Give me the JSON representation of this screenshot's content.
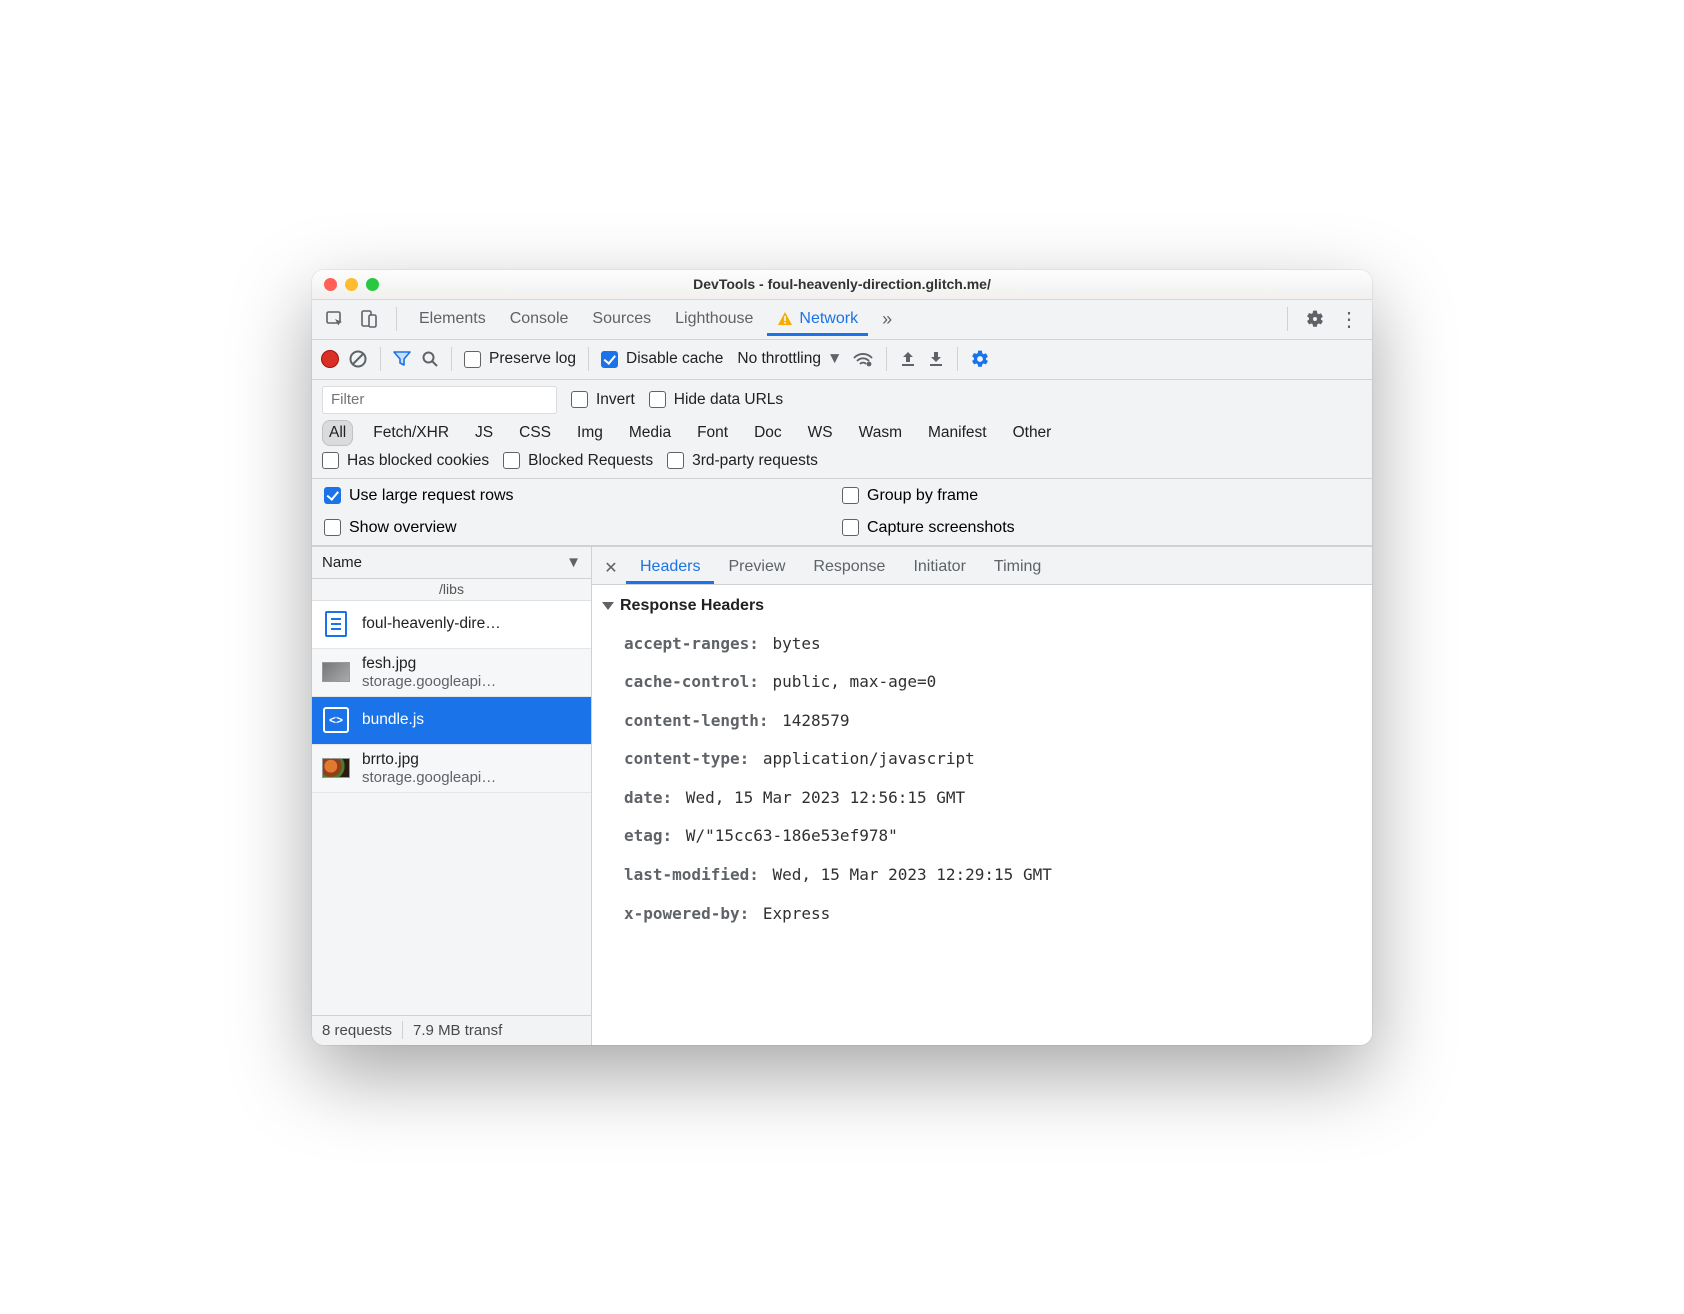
{
  "window_title": "DevTools - foul-heavenly-direction.glitch.me/",
  "top_tabs": {
    "elements": "Elements",
    "console": "Console",
    "sources": "Sources",
    "lighthouse": "Lighthouse",
    "network": "Network"
  },
  "toolbar": {
    "preserve_log": "Preserve log",
    "disable_cache": "Disable cache",
    "throttling": "No throttling"
  },
  "filter": {
    "placeholder": "Filter",
    "invert": "Invert",
    "hide_data_urls": "Hide data URLs",
    "types": [
      "All",
      "Fetch/XHR",
      "JS",
      "CSS",
      "Img",
      "Media",
      "Font",
      "Doc",
      "WS",
      "Wasm",
      "Manifest",
      "Other"
    ],
    "has_blocked_cookies": "Has blocked cookies",
    "blocked_requests": "Blocked Requests",
    "third_party": "3rd-party requests"
  },
  "settings": {
    "use_large_rows": "Use large request rows",
    "group_by_frame": "Group by frame",
    "show_overview": "Show overview",
    "capture_screenshots": "Capture screenshots"
  },
  "list_header": "Name",
  "partial_top": "/libs",
  "requests": [
    {
      "name": "foul-heavenly-dire…",
      "sub": "",
      "icon": "doc",
      "selected": false
    },
    {
      "name": "fesh.jpg",
      "sub": "storage.googleapi…",
      "icon": "img",
      "selected": false
    },
    {
      "name": "bundle.js",
      "sub": "",
      "icon": "js",
      "selected": true
    },
    {
      "name": "brrto.jpg",
      "sub": "storage.googleapi…",
      "icon": "img-food",
      "selected": false
    }
  ],
  "detail_tabs": [
    "Headers",
    "Preview",
    "Response",
    "Initiator",
    "Timing"
  ],
  "section_title": "Response Headers",
  "headers": [
    {
      "k": "accept-ranges:",
      "v": "bytes"
    },
    {
      "k": "cache-control:",
      "v": "public, max-age=0"
    },
    {
      "k": "content-length:",
      "v": "1428579"
    },
    {
      "k": "content-type:",
      "v": "application/javascript"
    },
    {
      "k": "date:",
      "v": "Wed, 15 Mar 2023 12:56:15 GMT"
    },
    {
      "k": "etag:",
      "v": "W/\"15cc63-186e53ef978\""
    },
    {
      "k": "last-modified:",
      "v": "Wed, 15 Mar 2023 12:29:15 GMT"
    },
    {
      "k": "x-powered-by:",
      "v": "Express"
    }
  ],
  "status": {
    "requests": "8 requests",
    "transfer": "7.9 MB transf"
  }
}
